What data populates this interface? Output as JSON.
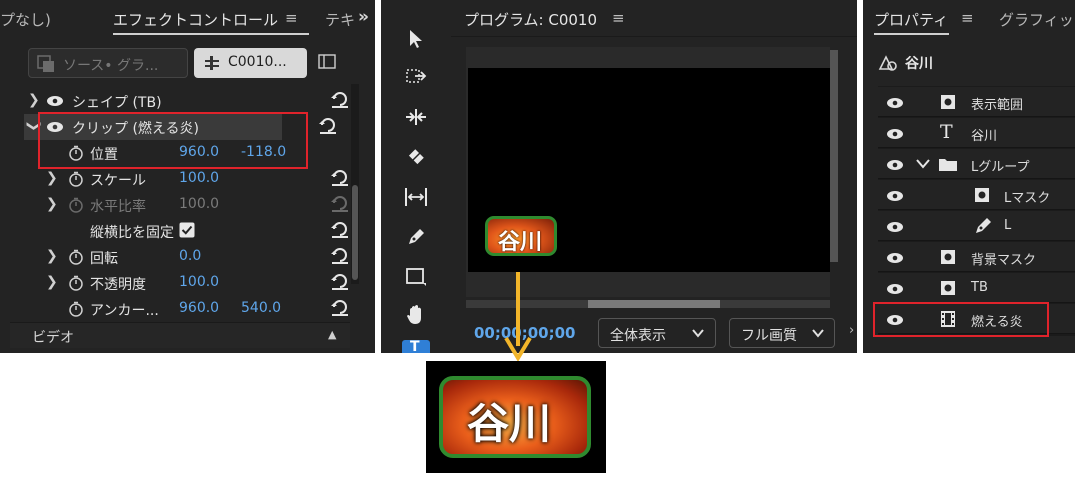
{
  "effect_controls": {
    "partial_tab": "プなし)",
    "active_tab": "エフェクトコントロール",
    "next_tab": "テキ",
    "overflow": "»",
    "menu": "≡",
    "source_button": "ソース• グラ...",
    "clip_button": "C0010...",
    "rows": [
      {
        "label": "シェイプ (TB)"
      },
      {
        "label": "クリップ (燃える炎)"
      },
      {
        "label": "位置",
        "v1": "960.0",
        "v2": "-118.0"
      },
      {
        "label": "スケール",
        "v1": "100.0"
      },
      {
        "label": "水平比率",
        "v1": "100.0"
      },
      {
        "label": "縦横比を固定"
      },
      {
        "label": "回転",
        "v1": "0.0"
      },
      {
        "label": "不透明度",
        "v1": "100.0"
      },
      {
        "label": "アンカー...",
        "v1": "960.0",
        "v2": "540.0"
      }
    ],
    "section_video": "ビデオ"
  },
  "program_monitor": {
    "title": "プログラム: C0010",
    "menu": "≡",
    "timecode": "00;00;00;00",
    "zoom_select": "全体表示",
    "quality_select": "フル画質",
    "title_text": "谷川"
  },
  "properties": {
    "active_tab": "プロパティ",
    "menu": "≡",
    "next_tab": "グラフィッ",
    "clip_name": "谷川",
    "layers": [
      {
        "name": "表示範囲",
        "icon": "mask-icon"
      },
      {
        "name": "谷川",
        "icon": "text-icon"
      },
      {
        "name": "Lグループ",
        "icon": "folder-icon"
      },
      {
        "name": "Lマスク",
        "icon": "mask-icon"
      },
      {
        "name": "L",
        "icon": "pen-icon"
      },
      {
        "name": "背景マスク",
        "icon": "mask-icon"
      },
      {
        "name": "TB",
        "icon": "mask-icon"
      },
      {
        "name": "燃える炎",
        "icon": "film-icon"
      }
    ]
  },
  "preview": {
    "text": "谷川"
  },
  "colors": {
    "highlight_box": "#e0232b",
    "arrow": "#f2b52a",
    "blue_value": "#5fa6ea",
    "title_border": "#2f8a2f"
  }
}
